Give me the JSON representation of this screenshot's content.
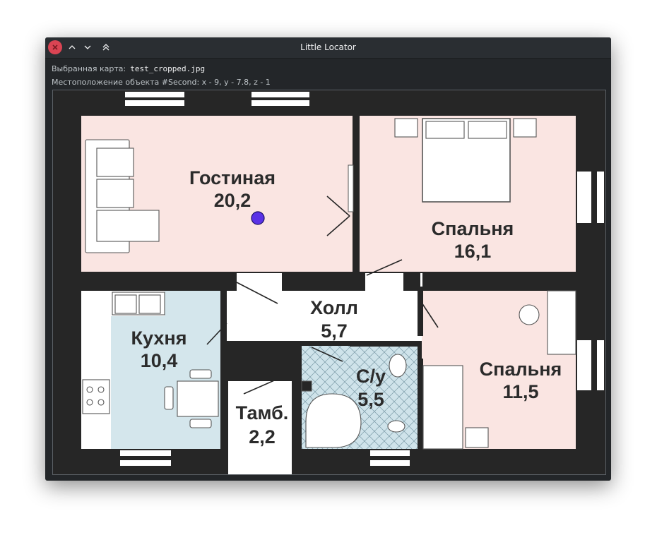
{
  "window": {
    "title": "Little Locator"
  },
  "info": {
    "map_label": "Выбранная карта:",
    "map_file": "test_cropped.jpg",
    "location_text": "Местоположение объекта #Second: x - 9, y - 7.8, z - 1"
  },
  "map": {
    "rooms": [
      {
        "name": "Гостиная",
        "area": "20,2"
      },
      {
        "name": "Спальня",
        "area": "16,1"
      },
      {
        "name": "Холл",
        "area": "5,7"
      },
      {
        "name": "Кухня",
        "area": "10,4"
      },
      {
        "name": "С/у",
        "area": "5,5"
      },
      {
        "name": "Спальня",
        "area": "11,5"
      },
      {
        "name": "Тамб.",
        "area": "2,2"
      }
    ],
    "marker": {
      "label": "Second",
      "color": "#5a32e6"
    }
  },
  "colors": {
    "close_button": "#da4453",
    "bedroom_fill": "#fae5e2",
    "kitchen_fill": "#d4e6ec",
    "bath_fill": "#cfe3ea",
    "wall": "#262626"
  }
}
